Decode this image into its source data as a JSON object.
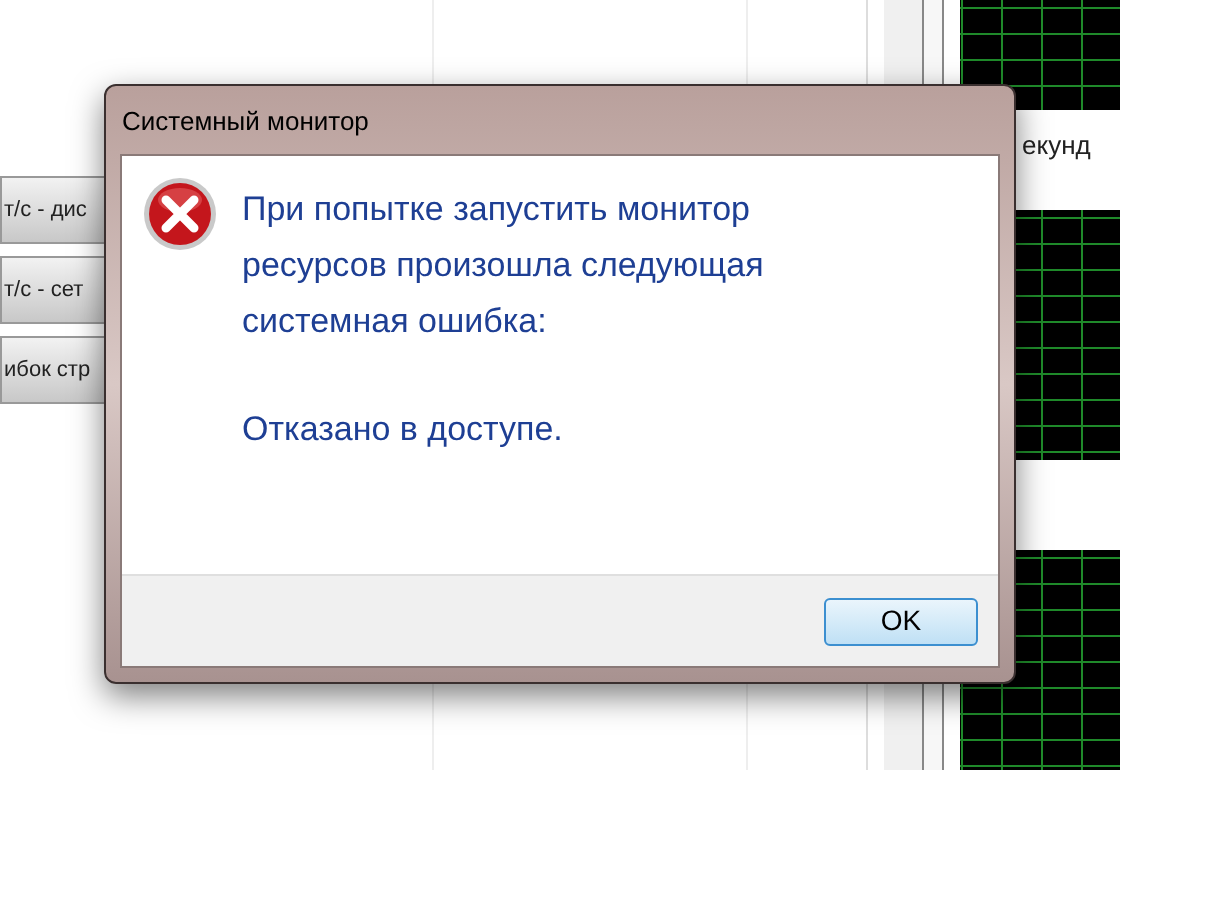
{
  "background": {
    "buttons": [
      {
        "label": "т/с - дис"
      },
      {
        "label": "т/с - сет"
      },
      {
        "label": "ибок стр"
      }
    ],
    "graph_labels": [
      "екунд"
    ]
  },
  "dialog": {
    "title": "Системный монитор",
    "message": "При попытке запустить монитор ресурсов произошла следующая системная ошибка:",
    "detail": "Отказано в доступе.",
    "buttons": [
      {
        "label": "OK",
        "default": true
      }
    ]
  }
}
